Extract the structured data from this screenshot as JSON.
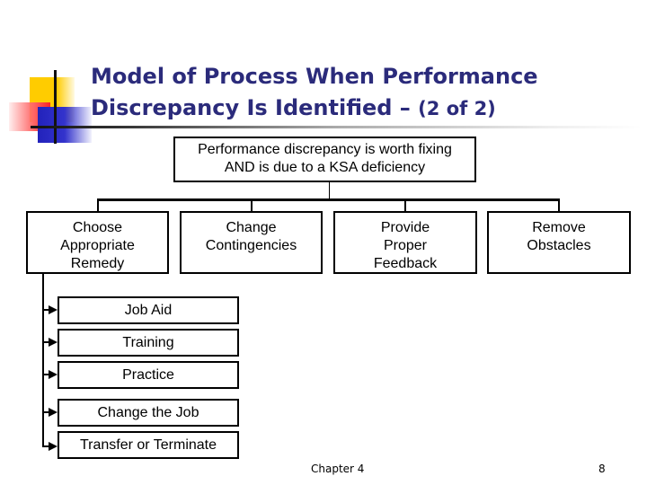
{
  "slide": {
    "title_main": "Model of Process When Performance Discrepancy Is Identified – ",
    "title_line1": "Model of Process When Performance",
    "title_line2": "Discrepancy Is Identified –",
    "title_suffix": "(2 of 2)",
    "title_color": "#2b2b7b"
  },
  "diagram": {
    "root": {
      "line1": "Performance discrepancy is worth fixing",
      "line2": "AND is due to a KSA deficiency"
    },
    "branches": [
      {
        "lines": [
          "Choose",
          "Appropriate",
          "Remedy"
        ]
      },
      {
        "lines": [
          "Change",
          "Contingencies"
        ]
      },
      {
        "lines": [
          "Provide",
          "Proper",
          "Feedback"
        ]
      },
      {
        "lines": [
          "Remove",
          "Obstacles"
        ]
      }
    ],
    "remedies": [
      {
        "label": "Job Aid"
      },
      {
        "label": "Training"
      },
      {
        "label": "Practice"
      },
      {
        "label": "Change the Job"
      },
      {
        "label": "Transfer or Terminate"
      }
    ]
  },
  "footer": {
    "chapter": "Chapter 4",
    "page": "8"
  }
}
